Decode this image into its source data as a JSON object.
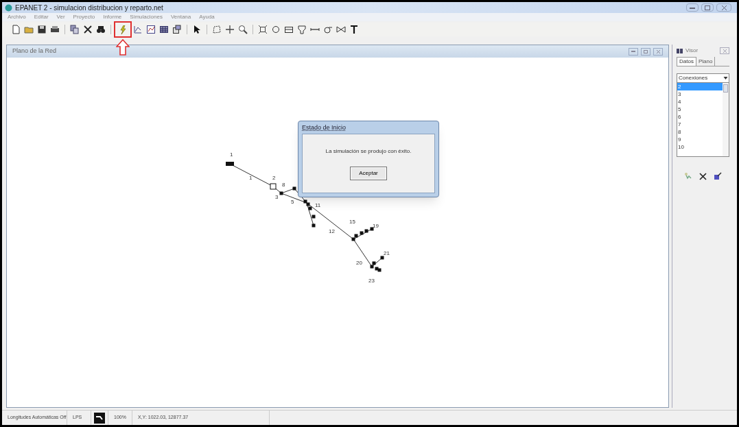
{
  "window": {
    "title": "EPANET 2 - simulacion distribucion y reparto.net"
  },
  "menu": [
    "Archivo",
    "Editar",
    "Ver",
    "Proyecto",
    "Informe",
    "Simulaciones",
    "Ventana",
    "Ayuda"
  ],
  "map_window": {
    "title": "Plano de la Red",
    "labels": [
      "1",
      "1",
      "2",
      "3",
      "8",
      "5",
      "11",
      "12",
      "15",
      "19",
      "20",
      "21",
      "23"
    ]
  },
  "dialog": {
    "title": "Estado de Inicio",
    "message": "La simulación se produjo con éxito.",
    "button": "Aceptar"
  },
  "browser": {
    "title": "Visor",
    "tabs": [
      {
        "label": "Datos",
        "selected": true
      },
      {
        "label": "Plano",
        "selected": false
      }
    ],
    "category": "Conexiones",
    "items": [
      {
        "label": "2",
        "selected": true
      },
      {
        "label": "3",
        "selected": false
      },
      {
        "label": "4",
        "selected": false
      },
      {
        "label": "5",
        "selected": false
      },
      {
        "label": "6",
        "selected": false
      },
      {
        "label": "7",
        "selected": false
      },
      {
        "label": "8",
        "selected": false
      },
      {
        "label": "9",
        "selected": false
      },
      {
        "label": "10",
        "selected": false
      }
    ]
  },
  "status_bar": [
    "Longitudes Automáticas Off",
    "LPS",
    "100%",
    "X,Y: 1022.03, 12877.37"
  ]
}
